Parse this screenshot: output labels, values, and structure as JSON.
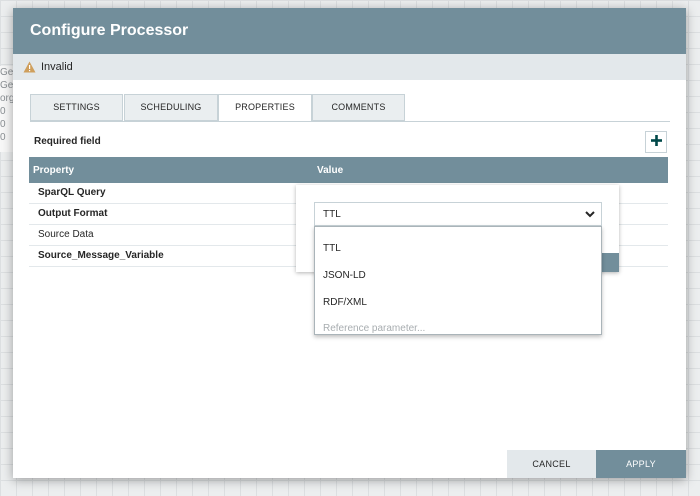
{
  "background": {
    "fragments": [
      "Ge",
      "Ge",
      "org",
      "0",
      "0",
      "0",
      "0"
    ]
  },
  "dialog": {
    "title": "Configure Processor",
    "status_text": "Invalid",
    "status_icon": "warning-icon",
    "tabs": [
      {
        "label": "SETTINGS",
        "active": false
      },
      {
        "label": "SCHEDULING",
        "active": false
      },
      {
        "label": "PROPERTIES",
        "active": true
      },
      {
        "label": "COMMENTS",
        "active": false
      }
    ],
    "required_field_label": "Required field",
    "add_icon": "plus-icon",
    "table": {
      "columns": [
        "Property",
        "Value"
      ],
      "rows": [
        {
          "name": "SparQL Query",
          "required": true
        },
        {
          "name": "Output Format",
          "required": true
        },
        {
          "name": "Source Data",
          "required": false
        },
        {
          "name": "Source_Message_Variable",
          "required": true
        }
      ]
    },
    "value_editor": {
      "selected": "TTL",
      "options": [
        "TTL",
        "JSON-LD",
        "RDF/XML"
      ],
      "reference_placeholder": "Reference parameter..."
    },
    "buttons": {
      "cancel": "CANCEL",
      "apply": "APPLY"
    }
  },
  "colors": {
    "header": "#728e9b",
    "status_bar": "#e3e8eb",
    "warning": "#cf9f5d"
  }
}
